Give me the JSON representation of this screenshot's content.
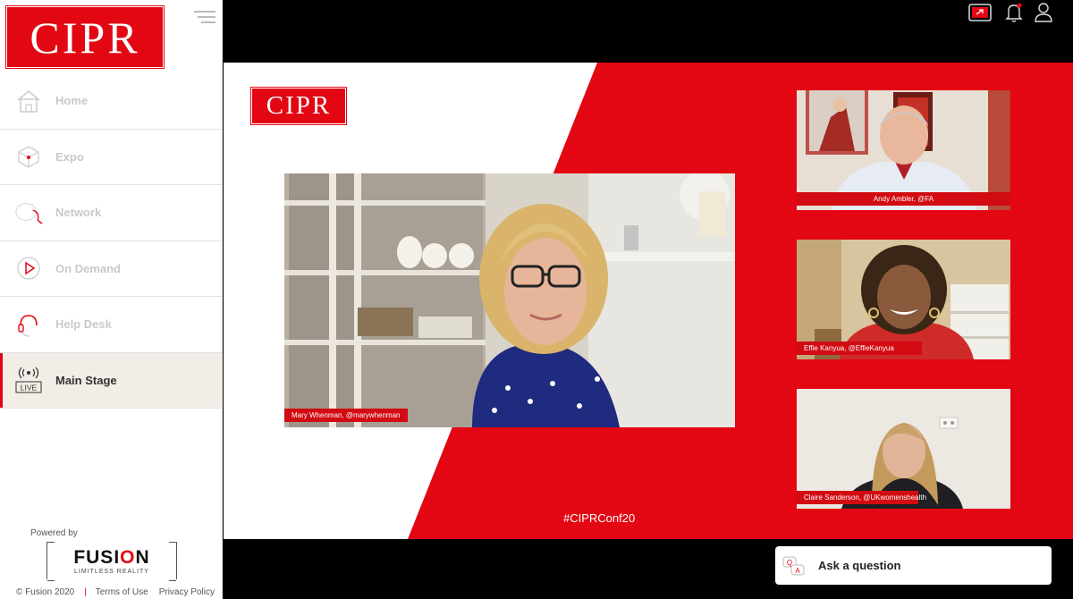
{
  "brand": {
    "logo_text": "CIPR",
    "accent": "#e30613"
  },
  "sidebar": {
    "items": [
      {
        "label": "Home",
        "icon": "home-icon"
      },
      {
        "label": "Expo",
        "icon": "expo-cube-icon"
      },
      {
        "label": "Network",
        "icon": "network-chat-icon"
      },
      {
        "label": "On Demand",
        "icon": "play-icon"
      },
      {
        "label": "Help Desk",
        "icon": "headset-icon"
      },
      {
        "label": "Main Stage",
        "icon": "live-broadcast-icon",
        "active": true,
        "badge": "LIVE"
      }
    ],
    "powered_by": "Powered by",
    "fusion": {
      "name_pre": "FUSI",
      "name_o": "O",
      "name_post": "N",
      "tagline": "LIMITLESS REALITY"
    },
    "footer": {
      "copyright": "© Fusion 2020",
      "terms": "Terms of Use",
      "privacy": "Privacy Policy"
    }
  },
  "topbar": {
    "icons": [
      "share-screen-icon",
      "bell-icon",
      "user-icon"
    ],
    "notification_dot": true
  },
  "stage": {
    "logo_text": "CIPR",
    "hashtag": "#CIPRConf20",
    "main_speaker": "Mary Whenman,  @marywhenman",
    "panel": [
      "Andy Ambler, @FA",
      "Effie Kanyua, @EffieKanyua",
      "Claire Sanderson, @UKwomenshealth"
    ]
  },
  "ask": {
    "label": "Ask a question",
    "icon": "qa-icon"
  }
}
